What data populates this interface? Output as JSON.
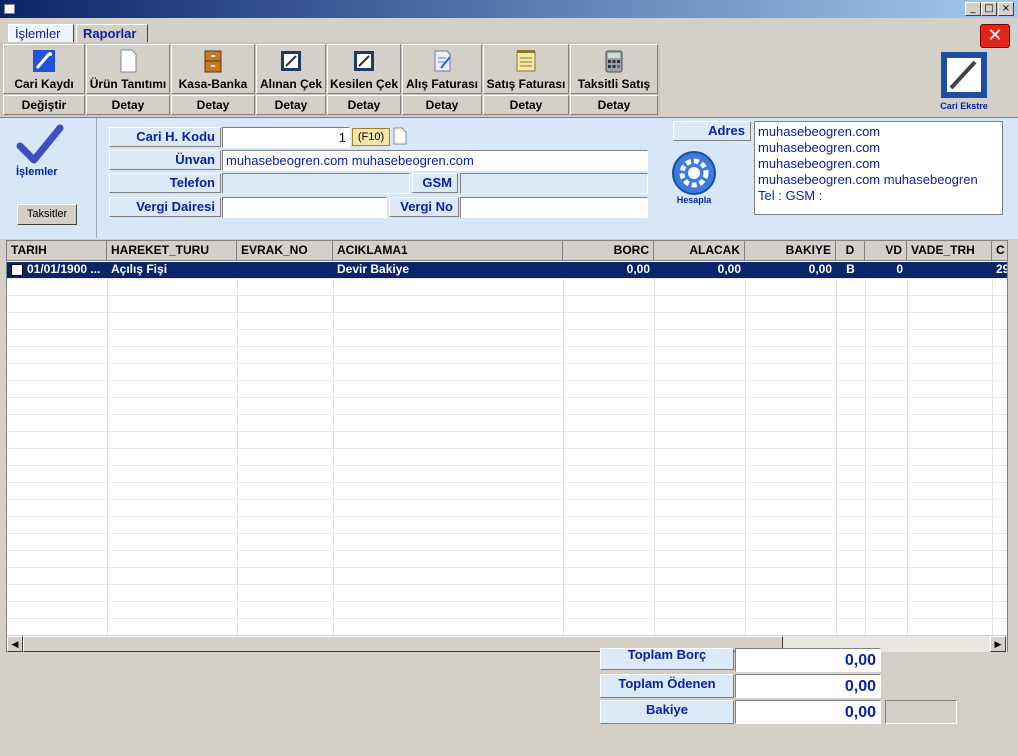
{
  "tabs": {
    "islemler": "İşlemler",
    "raporlar": "Raporlar"
  },
  "toolbar": {
    "buttons": [
      {
        "label": "Cari Kaydı",
        "sub": "Değiştir"
      },
      {
        "label": "Ürün Tanıtımı",
        "sub": "Detay"
      },
      {
        "label": "Kasa-Banka",
        "sub": "Detay"
      },
      {
        "label": "Alınan Çek",
        "sub": "Detay"
      },
      {
        "label": "Kesilen Çek",
        "sub": "Detay"
      },
      {
        "label": "Alış Faturası",
        "sub": "Detay"
      },
      {
        "label": "Satış Faturası",
        "sub": "Detay"
      },
      {
        "label": "Taksitli Satış",
        "sub": "Detay"
      }
    ],
    "cari_ekstre": "Cari Ekstre"
  },
  "left": {
    "islemler": "İşlemler",
    "taksitler": "Taksitler"
  },
  "form": {
    "cari_kodu_label": "Cari H. Kodu",
    "cari_kodu": "1",
    "f10": "(F10)",
    "unvan_label": "Ünvan",
    "unvan": "muhasebeogren.com     muhasebeogren.com",
    "telefon_label": "Telefon",
    "telefon": "",
    "gsm_label": "GSM",
    "gsm": "",
    "vergi_dairesi_label": "Vergi Dairesi",
    "vergi_dairesi": "",
    "vergi_no_label": "Vergi  No",
    "vergi_no": "",
    "adres_label": "Adres",
    "adres_lines": [
      "muhasebeogren.com",
      "muhasebeogren.com",
      "muhasebeogren.com",
      "muhasebeogren.com     muhasebeogren",
      " Tel :  GSM :"
    ],
    "hesapla": "Hesapla"
  },
  "grid": {
    "columns": [
      "TARIH",
      "HAREKET_TURU",
      "EVRAK_NO",
      "ACIKLAMA1",
      "BORC",
      "ALACAK",
      "BAKIYE",
      "D",
      "VD",
      "VADE_TRH",
      "C"
    ],
    "row": [
      "01/01/1900 ...",
      "Açılış Fişi",
      "",
      "Devir Bakiye",
      "0,00",
      "0,00",
      "0,00",
      "B",
      "0",
      "",
      "29"
    ]
  },
  "totals": {
    "toplam_borc_label": "Toplam Borç",
    "toplam_borc": "0,00",
    "toplam_odenen_label": "Toplam Ödenen",
    "toplam_odenen": "0,00",
    "bakiye_label": "Bakiye",
    "bakiye": "0,00"
  }
}
